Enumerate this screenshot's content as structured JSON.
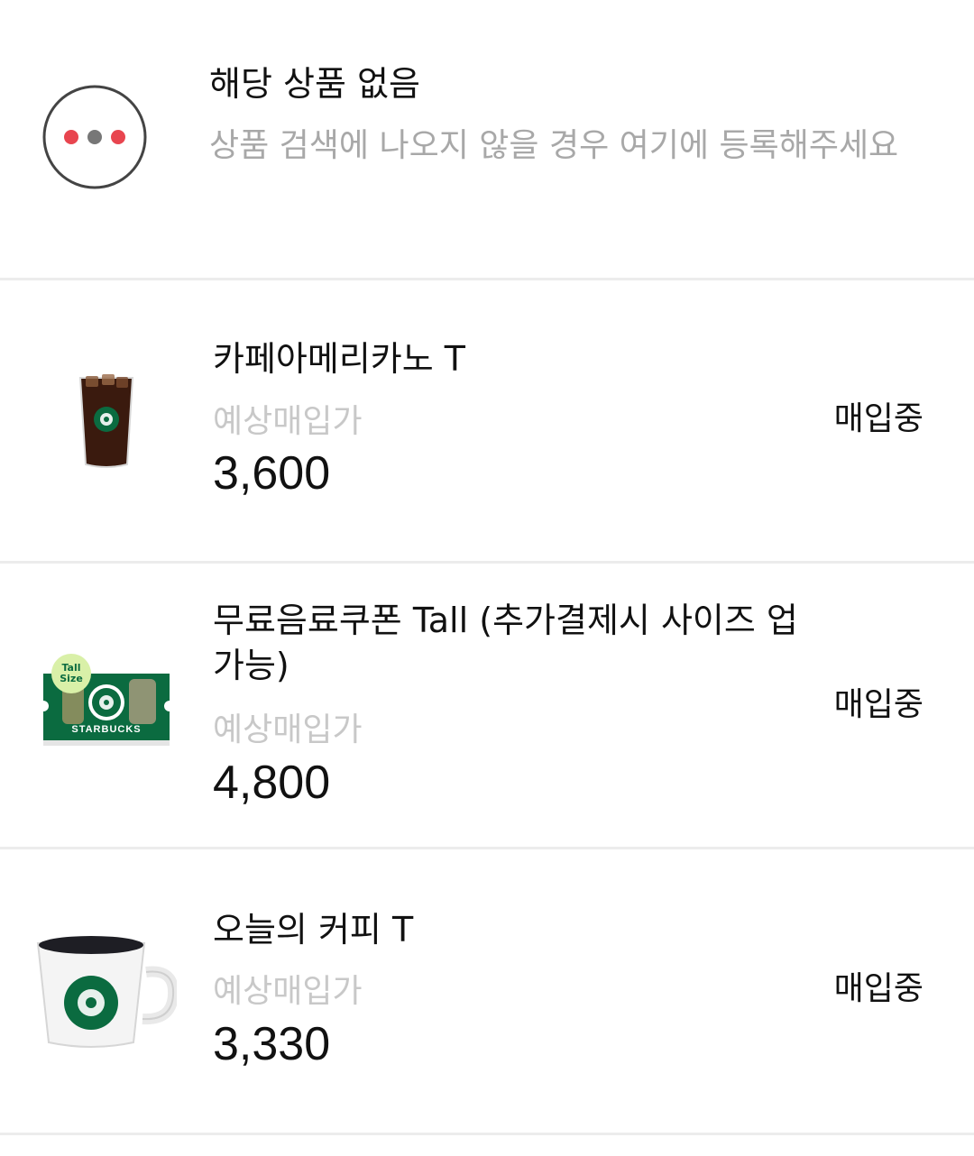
{
  "none_item": {
    "title": "해당 상품 없음",
    "description": "상품 검색에 나오지 않을 경우 여기에 등록해주세요",
    "icon": "more-dots-icon"
  },
  "products": [
    {
      "name": "카페아메리카노 T",
      "price_label": "예상매입가",
      "price": "3,600",
      "status": "매입중",
      "image": "iced-americano"
    },
    {
      "name": "무료음료쿠폰 Tall (추가결제시 사이즈 업가능)",
      "price_label": "예상매입가",
      "price": "4,800",
      "status": "매입중",
      "image": "coupon-card",
      "badge": "Tall Size",
      "brand": "STARBUCKS"
    },
    {
      "name": "오늘의 커피 T",
      "price_label": "예상매입가",
      "price": "3,330",
      "status": "매입중",
      "image": "coffee-mug"
    }
  ],
  "colors": {
    "dot_red": "#e8454f",
    "dot_gray": "#777777",
    "starbucks_green": "#0b6b40",
    "divider": "#ececec"
  }
}
